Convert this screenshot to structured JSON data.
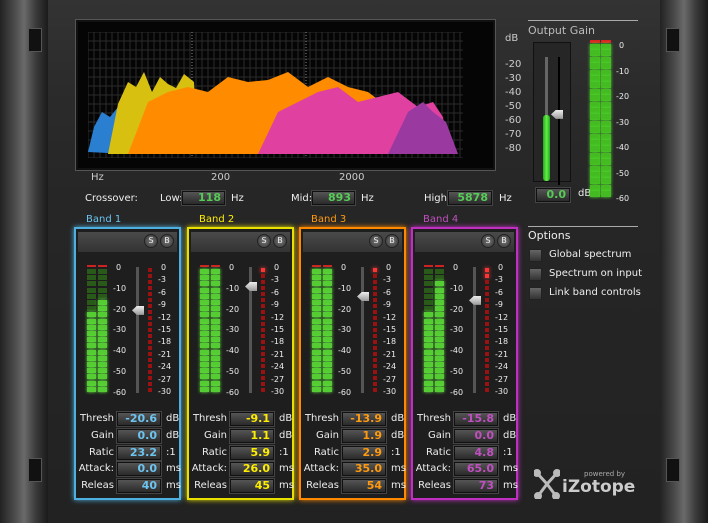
{
  "spectrum": {
    "db_unit": "dB",
    "db_labels": [
      "-20",
      "-30",
      "-40",
      "-50",
      "-60",
      "-70",
      "-80"
    ],
    "hz_labels": [
      "Hz",
      "200",
      "2000"
    ]
  },
  "crossover": {
    "label": "Crossover:",
    "low_label": "Low:",
    "low_value": "118",
    "mid_label": "Mid:",
    "mid_value": "893",
    "high_label": "High:",
    "high_value": "5878",
    "unit": "Hz"
  },
  "band_common": {
    "solo": "S",
    "bypass": "B",
    "meter_scale": [
      "0",
      "-10",
      "-20",
      "-30",
      "-40",
      "-50",
      "-60"
    ],
    "gr_scale": [
      "0",
      "-3",
      "-6",
      "-9",
      "-12",
      "-15",
      "-18",
      "-21",
      "-24",
      "-27",
      "-30"
    ],
    "param_labels": [
      "Thresh",
      "Gain",
      "Ratic",
      "Attack:",
      "Releas"
    ],
    "param_units": [
      "dB",
      "dB",
      ":1",
      "ms",
      "ms"
    ]
  },
  "bands": [
    {
      "title": "Band 1",
      "color": "#4fb0e0",
      "text_color": "#6cc4f0",
      "level_db": -20,
      "peak_db": -15,
      "gr_db": 0,
      "values": [
        "-20.6",
        "0.0",
        "23.2",
        "0.0",
        "40"
      ],
      "threshold_db": -20.6
    },
    {
      "title": "Band 2",
      "color": "#e8e000",
      "text_color": "#ffee00",
      "level_db": 0,
      "peak_db": 0,
      "gr_db": -1,
      "values": [
        "-9.1",
        "1.1",
        "5.9",
        "26.0",
        "45"
      ],
      "threshold_db": -9.1
    },
    {
      "title": "Band 3",
      "color": "#ff8a00",
      "text_color": "#ff9a10",
      "level_db": 0,
      "peak_db": 0,
      "gr_db": -1,
      "values": [
        "-13.9",
        "1.9",
        "2.9",
        "35.0",
        "54"
      ],
      "threshold_db": -13.9
    },
    {
      "title": "Band 4",
      "color": "#c030c0",
      "text_color": "#c050c0",
      "level_db": -20,
      "peak_db": -5,
      "gr_db": -2,
      "values": [
        "-15.8",
        "0.0",
        "4.8",
        "65.0",
        "73"
      ],
      "threshold_db": -15.8
    }
  ],
  "output_gain": {
    "title": "Output Gain",
    "value": "0.0",
    "unit": "dB",
    "slider_db": -28,
    "scale": [
      "0",
      "-10",
      "-20",
      "-30",
      "-40",
      "-50",
      "-60"
    ]
  },
  "options": {
    "title": "Options",
    "items": [
      {
        "label": "Global spectrum",
        "checked": false
      },
      {
        "label": "Spectrum on input",
        "checked": false
      },
      {
        "label": "Link band controls",
        "checked": false
      }
    ]
  },
  "logo": {
    "tagline": "powered by",
    "name": "iZotope"
  }
}
